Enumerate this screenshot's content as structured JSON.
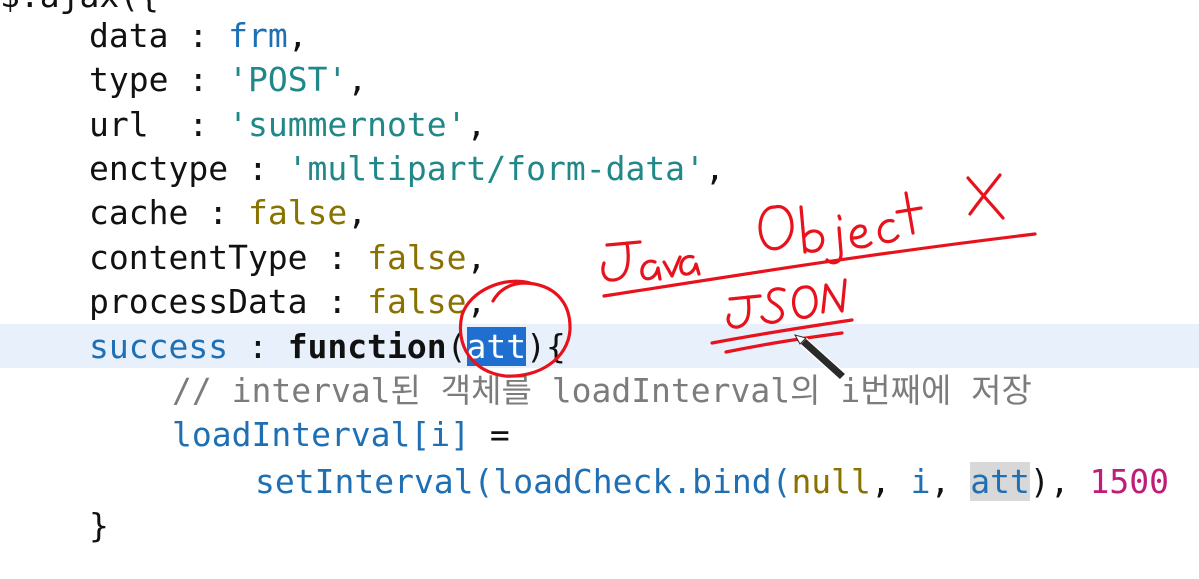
{
  "code": {
    "top_fragment": "$.ajax({",
    "lines": {
      "data": {
        "key": "data",
        "sep": " : ",
        "value": "frm",
        "end": ","
      },
      "type": {
        "key": "type",
        "sep": " : ",
        "value": "'POST'",
        "end": ","
      },
      "url": {
        "key": "url",
        "sep": "  : ",
        "value": "'summernote'",
        "end": ","
      },
      "enctype": {
        "key": "enctype",
        "sep": " : ",
        "value": "'multipart/form-data'",
        "end": ","
      },
      "cache": {
        "key": "cache",
        "sep": " : ",
        "value": "false",
        "end": ","
      },
      "contentType": {
        "key": "contentType",
        "sep": " : ",
        "value": "false",
        "end": ","
      },
      "processData": {
        "key": "processData",
        "sep": " : ",
        "value": "false",
        "end": ","
      },
      "success": {
        "key": "success",
        "sep": " : ",
        "keyword": "function",
        "open": "(",
        "param": "att",
        "close": "){"
      },
      "comment": "// interval된 객체를 loadInterval의 i번째에 저장",
      "assign": {
        "target": "loadInterval[i]",
        "op": " ="
      },
      "call": {
        "fn": "setInterval(",
        "inner": "loadCheck.bind(",
        "arg_null": "null",
        "sep1": ", ",
        "arg_i": "i",
        "sep2": ", ",
        "arg_att": "att",
        "close": "), ",
        "delay": "1500"
      },
      "close_brace": "}"
    }
  },
  "annotations": {
    "handwriting_1": "Java Object X",
    "handwriting_2": "JSON",
    "ink_color": "#e8121c"
  },
  "colors": {
    "selection": "#1e6fd0",
    "current_line": "#e8f0fb",
    "identifier": "#1f6fb5",
    "string": "#208888",
    "boolean": "#8a7200",
    "comment": "#7c7c7c",
    "number": "#c11b7a"
  }
}
